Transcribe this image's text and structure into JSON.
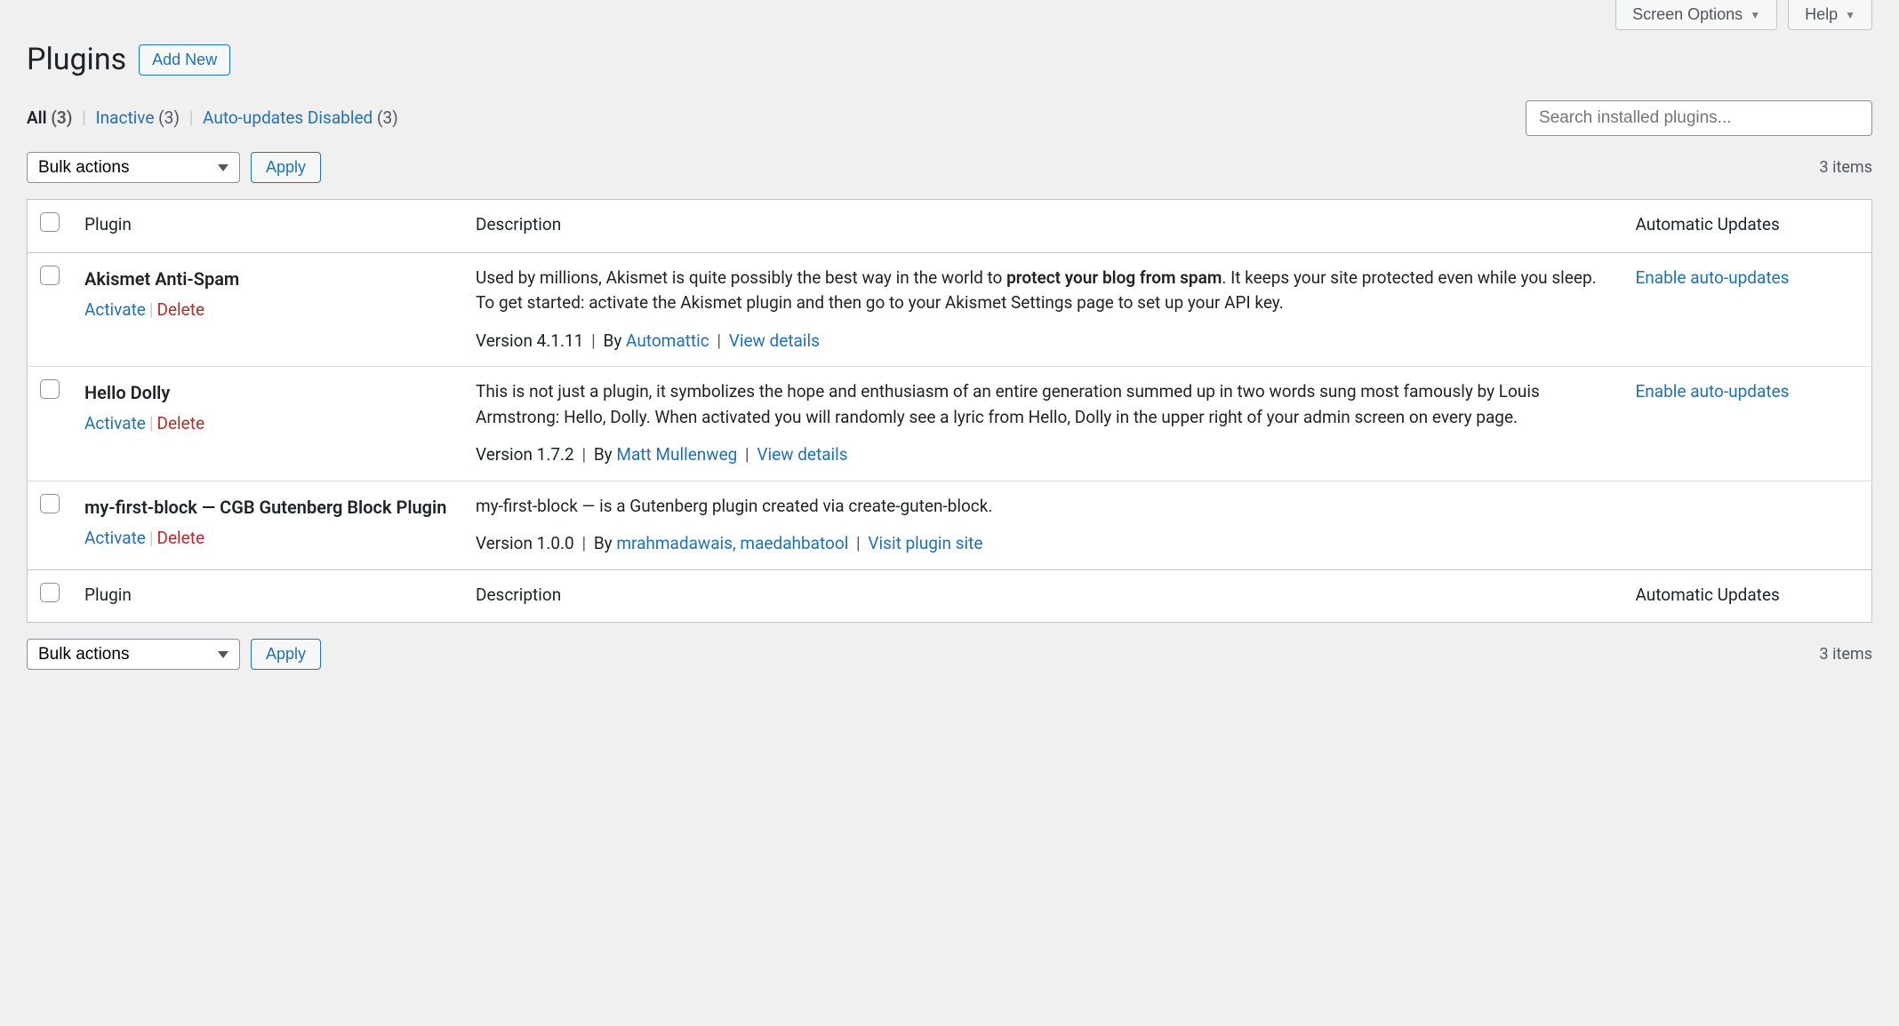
{
  "top_tabs": {
    "screen_options": "Screen Options",
    "help": "Help"
  },
  "heading": {
    "title": "Plugins",
    "add_new": "Add New"
  },
  "filters": {
    "all_label": "All",
    "all_count": "(3)",
    "inactive_label": "Inactive",
    "inactive_count": "(3)",
    "auto_disabled_label": "Auto-updates Disabled",
    "auto_disabled_count": "(3)"
  },
  "search": {
    "placeholder": "Search installed plugins..."
  },
  "bulk": {
    "label": "Bulk actions",
    "apply": "Apply"
  },
  "items_count": "3 items",
  "columns": {
    "plugin": "Plugin",
    "description": "Description",
    "auto_updates": "Automatic Updates"
  },
  "row_actions": {
    "activate": "Activate",
    "delete": "Delete"
  },
  "auto_update_link": "Enable auto-updates",
  "plugins": [
    {
      "name": "Akismet Anti-Spam",
      "desc_pre": "Used by millions, Akismet is quite possibly the best way in the world to ",
      "desc_bold": "protect your blog from spam",
      "desc_post": ". It keeps your site protected even while you sleep. To get started: activate the Akismet plugin and then go to your Akismet Settings page to set up your API key.",
      "version_label": "Version 4.1.11",
      "by_label": "By",
      "author": "Automattic",
      "details_label": "View details",
      "show_auto": true
    },
    {
      "name": "Hello Dolly",
      "desc_pre": "This is not just a plugin, it symbolizes the hope and enthusiasm of an entire generation summed up in two words sung most famously by Louis Armstrong: Hello, Dolly. When activated you will randomly see a lyric from Hello, Dolly in the upper right of your admin screen on every page.",
      "desc_bold": "",
      "desc_post": "",
      "version_label": "Version 1.7.2",
      "by_label": "By",
      "author": "Matt Mullenweg",
      "details_label": "View details",
      "show_auto": true
    },
    {
      "name": "my-first-block — CGB Gutenberg Block Plugin",
      "desc_pre": "my-first-block — is a Gutenberg plugin created via create-guten-block.",
      "desc_bold": "",
      "desc_post": "",
      "version_label": "Version 1.0.0",
      "by_label": "By",
      "author": "mrahmadawais, maedahbatool",
      "details_label": "Visit plugin site",
      "show_auto": false
    }
  ]
}
